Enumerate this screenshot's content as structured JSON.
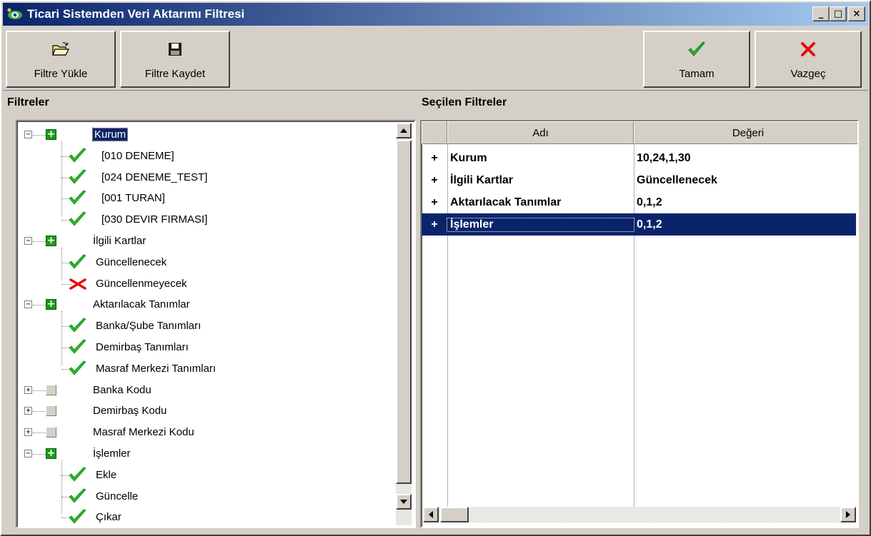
{
  "window": {
    "title": "Ticari Sistemden Veri Aktarımı Filtresi",
    "controls": {
      "minimize": "_",
      "maximize": "□",
      "close": "×"
    }
  },
  "toolbar": {
    "load": {
      "label": "Filtre Yükle",
      "icon": "open-folder-icon"
    },
    "save": {
      "label": "Filtre Kaydet",
      "icon": "floppy-disk-icon"
    },
    "ok": {
      "label": "Tamam",
      "icon": "green-check-icon"
    },
    "cancel": {
      "label": "Vazgeç",
      "icon": "red-x-icon"
    }
  },
  "left_panel": {
    "label": "Filtreler",
    "tree": [
      {
        "label": "Kurum",
        "state": "expanded",
        "selected": true,
        "children": [
          {
            "label": "[010 DENEME]",
            "mark": "check"
          },
          {
            "label": "[024 DENEME_TEST]",
            "mark": "check"
          },
          {
            "label": "[001 TURAN]",
            "mark": "check"
          },
          {
            "label": "[030 DEVIR FIRMASI]",
            "mark": "check"
          }
        ]
      },
      {
        "label": "İlgili Kartlar",
        "state": "expanded",
        "children": [
          {
            "label": "Güncellenecek",
            "mark": "check"
          },
          {
            "label": "Güncellenmeyecek",
            "mark": "cross"
          }
        ]
      },
      {
        "label": "Aktarılacak Tanımlar",
        "state": "expanded",
        "children": [
          {
            "label": "Banka/Şube Tanımları",
            "mark": "check"
          },
          {
            "label": "Demirbaş Tanımları",
            "mark": "check"
          },
          {
            "label": "Masraf Merkezi Tanımları",
            "mark": "check"
          }
        ]
      },
      {
        "label": "Banka Kodu",
        "state": "collapsed",
        "children": []
      },
      {
        "label": "Demirbaş Kodu",
        "state": "collapsed",
        "children": []
      },
      {
        "label": "Masraf Merkezi Kodu",
        "state": "collapsed",
        "children": []
      },
      {
        "label": "İşlemler",
        "state": "expanded",
        "children": [
          {
            "label": "Ekle",
            "mark": "check"
          },
          {
            "label": "Güncelle",
            "mark": "check"
          },
          {
            "label": "Çıkar",
            "mark": "check"
          }
        ]
      }
    ]
  },
  "right_panel": {
    "label": "Seçilen Filtreler",
    "columns": [
      "Adı",
      "Değeri"
    ],
    "rows": [
      {
        "indicator": "+",
        "name": "Kurum",
        "value": "10,24,1,30",
        "selected": false
      },
      {
        "indicator": "+",
        "name": "İlgili Kartlar",
        "value": "Güncellenecek",
        "selected": false
      },
      {
        "indicator": "+",
        "name": "Aktarılacak Tanımlar",
        "value": "0,1,2",
        "selected": false
      },
      {
        "indicator": "+",
        "name": "İşlemler",
        "value": "0,1,2",
        "selected": true
      }
    ]
  },
  "colors": {
    "titlebar_start": "#0a246a",
    "titlebar_end": "#a6caf0",
    "selection": "#0a246a",
    "check_green": "#2bb52b",
    "cross_red": "#e01010"
  }
}
